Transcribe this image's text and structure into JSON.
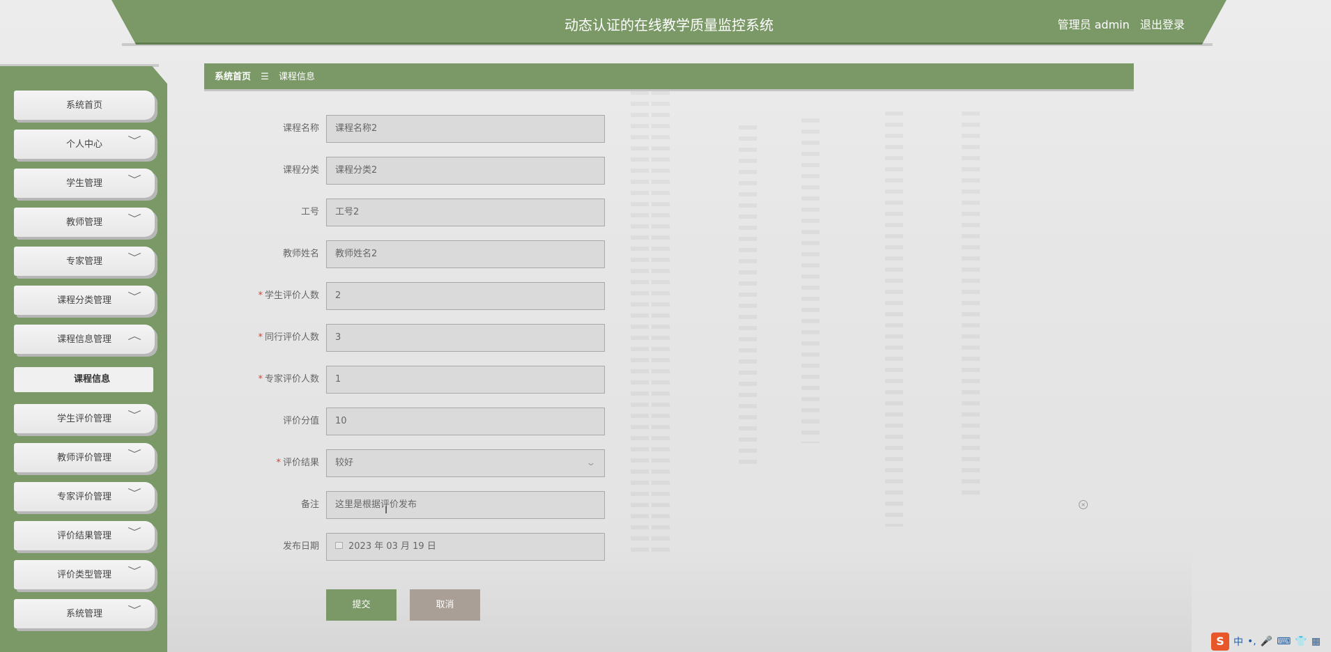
{
  "header": {
    "title": "动态认证的在线教学质量监控系统",
    "user_role": "管理员 admin",
    "logout_label": "退出登录"
  },
  "sidebar": {
    "items": [
      {
        "label": "系统首页",
        "expandable": false
      },
      {
        "label": "个人中心",
        "expandable": true
      },
      {
        "label": "学生管理",
        "expandable": true
      },
      {
        "label": "教师管理",
        "expandable": true
      },
      {
        "label": "专家管理",
        "expandable": true
      },
      {
        "label": "课程分类管理",
        "expandable": true
      },
      {
        "label": "课程信息管理",
        "expandable": true,
        "expanded": true
      },
      {
        "label": "学生评价管理",
        "expandable": true
      },
      {
        "label": "教师评价管理",
        "expandable": true
      },
      {
        "label": "专家评价管理",
        "expandable": true
      },
      {
        "label": "评价结果管理",
        "expandable": true
      },
      {
        "label": "评价类型管理",
        "expandable": true
      },
      {
        "label": "系统管理",
        "expandable": true
      }
    ],
    "active_subitem": "课程信息",
    "chevron_down": "﹀",
    "chevron_up": "︿"
  },
  "breadcrumb": {
    "home": "系统首页",
    "separator": "☰",
    "current": "课程信息"
  },
  "form": {
    "fields": [
      {
        "label": "课程名称",
        "value": "课程名称2",
        "required": false
      },
      {
        "label": "课程分类",
        "value": "课程分类2",
        "required": false
      },
      {
        "label": "工号",
        "value": "工号2",
        "required": false
      },
      {
        "label": "教师姓名",
        "value": "教师姓名2",
        "required": false
      },
      {
        "label": "学生评价人数",
        "value": "2",
        "required": true
      },
      {
        "label": "同行评价人数",
        "value": "3",
        "required": true
      },
      {
        "label": "专家评价人数",
        "value": "1",
        "required": true
      },
      {
        "label": "评价分值",
        "value": "10",
        "required": false
      },
      {
        "label": "评价结果",
        "value": "较好",
        "required": true,
        "type": "select"
      },
      {
        "label": "备注",
        "value": "这里是根据评价发布",
        "required": false
      },
      {
        "label": "发布日期",
        "value": "2023 年 03 月 19 日",
        "required": false,
        "type": "date"
      }
    ],
    "required_mark": "*",
    "submit_label": "提交",
    "cancel_label": "取消"
  },
  "ime": {
    "logo": "S",
    "lang": "中",
    "punct": "•,",
    "mic": "🎤",
    "keyboard": "⌨",
    "skin": "👕",
    "grid": "▦"
  },
  "colors": {
    "primary": "#7a9966",
    "cancel": "#a99f96",
    "required": "#e0402b"
  }
}
